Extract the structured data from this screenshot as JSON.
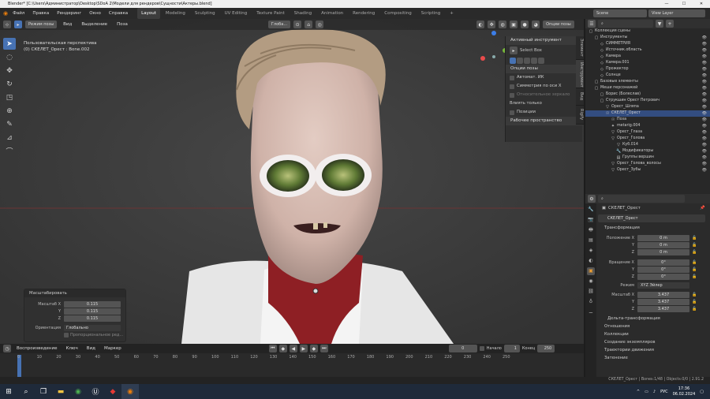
{
  "title": "Blender* [C:\\Users\\Администратор\\Desktop\\SDoA 2\\Модели для рендеров\\Сущности\\Актеры.blend]",
  "menu": [
    "Файл",
    "Правка",
    "Рендеринг",
    "Окно",
    "Справка"
  ],
  "workspaces": [
    "Layout",
    "Modeling",
    "Sculpting",
    "UV Editing",
    "Texture Paint",
    "Shading",
    "Animation",
    "Rendering",
    "Compositing",
    "Scripting"
  ],
  "scene": {
    "label": "Scene",
    "view_layer": "View Layer"
  },
  "viewport": {
    "mode": "Режим позы",
    "menus": [
      "Вид",
      "Выделение",
      "Поза"
    ],
    "orientation": "Глоба...",
    "info_line1": "Пользовательская перспектива",
    "info_line2": "(0) СКЕЛЕТ_Орест : Bone.002",
    "options": "Опции позы"
  },
  "npanel": {
    "active_tool_title": "Активный инструмент",
    "tool_name": "Select Box",
    "pose_options": "Опции позы",
    "auto_ik": "Автомат. ИК",
    "x_mirror": "Симметрия по оси X",
    "relative_mirror": "Относительное зеркало",
    "affect_only": "Влиять только",
    "positions": "Позиции",
    "workspace": "Рабочее пространство",
    "tabs": [
      "Элемент",
      "Инструмент",
      "Вид",
      "Rigify"
    ]
  },
  "redo": {
    "title": "Масштабировать",
    "fields": [
      {
        "label": "Масштаб X",
        "value": "0.115"
      },
      {
        "label": "Y",
        "value": "0.115"
      },
      {
        "label": "Z",
        "value": "0.115"
      }
    ],
    "orientation_label": "Ориентация",
    "orientation_value": "Глобально",
    "proportional": "Пропорциональное ред..."
  },
  "timeline": {
    "menus": [
      "Воспроизведение",
      "Ключ",
      "Вид",
      "Маркер"
    ],
    "current": "0",
    "start_label": "Начало",
    "start": "1",
    "end_label": "Конец",
    "end": "250",
    "ticks": [
      "0",
      "10",
      "20",
      "30",
      "40",
      "50",
      "60",
      "70",
      "80",
      "90",
      "100",
      "110",
      "120",
      "130",
      "140",
      "150",
      "160",
      "170",
      "180",
      "190",
      "200",
      "210",
      "220",
      "230",
      "240",
      "250"
    ]
  },
  "outliner": {
    "rows": [
      {
        "t": "Коллекция сцены",
        "d": 0
      },
      {
        "t": "Инструменты",
        "d": 1
      },
      {
        "t": "СИММЕТРИЯ",
        "d": 2
      },
      {
        "t": "Источник.область",
        "d": 2
      },
      {
        "t": "Камера",
        "d": 2
      },
      {
        "t": "Камера.001",
        "d": 2
      },
      {
        "t": "Прожектор",
        "d": 2
      },
      {
        "t": "Солнце",
        "d": 2
      },
      {
        "t": "Базовые элементы",
        "d": 1
      },
      {
        "t": "Меши персонажей",
        "d": 1
      },
      {
        "t": "Борис (Болеслав)",
        "d": 2
      },
      {
        "t": "Струкшин Орест Петрович",
        "d": 2
      },
      {
        "t": "Орест_Шляпа",
        "d": 3
      },
      {
        "t": "СКЕЛЕТ_Орест",
        "d": 3,
        "sel": true
      },
      {
        "t": "Поза",
        "d": 4
      },
      {
        "t": "metarig.004",
        "d": 4
      },
      {
        "t": "Орест_Глаза",
        "d": 4
      },
      {
        "t": "Орест_Голова",
        "d": 4
      },
      {
        "t": "Куб.014",
        "d": 5
      },
      {
        "t": "Модификаторы",
        "d": 5
      },
      {
        "t": "Группы вершин",
        "d": 5
      },
      {
        "t": "Орест_Голова_волосы",
        "d": 4
      },
      {
        "t": "Орест_Зубы",
        "d": 4
      }
    ]
  },
  "props": {
    "object": "СКЕЛЕТ_Орест",
    "name": "СКЕЛЕТ_Орест",
    "transform": "Трансформация",
    "loc_label": [
      "Положение X",
      "Y",
      "Z"
    ],
    "loc": [
      "0 m",
      "0 m",
      "0 m"
    ],
    "rot_label": [
      "Вращение X",
      "Y",
      "Z"
    ],
    "rot": [
      "0°",
      "0°",
      "0°"
    ],
    "mode_label": "Режим",
    "mode": "XYZ Эйлер",
    "scale_label": [
      "Масштаб X",
      "Y",
      "Z"
    ],
    "scale": [
      "3.437",
      "3.437",
      "3.437"
    ],
    "sections": [
      "Дельта-трансформация",
      "Отношения",
      "Коллекции",
      "Создание экземпляров",
      "Траектории движения",
      "Затенение"
    ]
  },
  "status": {
    "right": "СКЕЛЕТ_Орест | Bones:1/48 | Objects:0/0 | 2.91.2"
  },
  "taskbar": {
    "time": "17:36",
    "date": "06.02.2024",
    "lang": "РУС"
  }
}
